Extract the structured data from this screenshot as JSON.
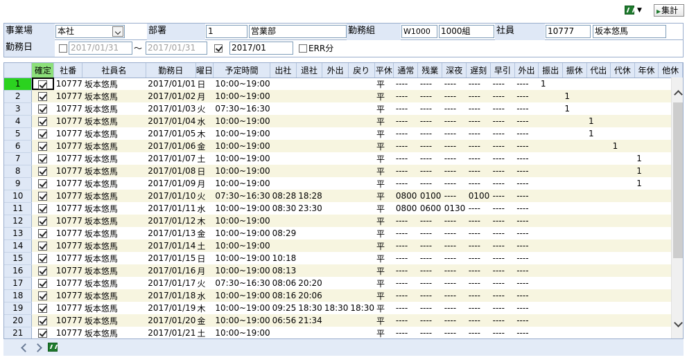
{
  "toolbar": {
    "excel_icon": "excel-icon",
    "sum_label": "集計"
  },
  "filter": {
    "office_label": "事業場",
    "office_value": "本社",
    "dept_label": "部署",
    "dept_code": "1",
    "dept_name": "営業部",
    "group_label": "勤務組",
    "group_code": "W1000",
    "group_name": "1000組",
    "employee_label": "社員",
    "employee_code": "10777",
    "employee_name": "坂本悠馬",
    "workdate_label": "勤務日",
    "date_from": "2017/01/31",
    "tilde": "～",
    "date_to": "2017/01/31",
    "month_value": "2017/01",
    "err_label": "ERR分"
  },
  "grid": {
    "columns": [
      "確定",
      "社番",
      "社員名",
      "勤務日",
      "曜日",
      "予定時間",
      "出社",
      "退社",
      "外出",
      "戻り",
      "平休",
      "通常",
      "残業",
      "深夜",
      "遅刻",
      "早引",
      "外出",
      "振出",
      "振休",
      "代出",
      "代休",
      "年休",
      "他休"
    ],
    "rows": [
      {
        "n": "1",
        "code": "10777",
        "name": "坂本悠馬",
        "date": "2017/01/01",
        "dow": "日",
        "plan": "10:00~19:00",
        "in": "",
        "out": "",
        "go": "",
        "back": "",
        "ph": "平",
        "n1": "----",
        "ot": "----",
        "ng": "----",
        "late": "----",
        "early": "----",
        "gout": "----",
        "fsh": "1",
        "fky": "",
        "dsh": "",
        "dky": "",
        "nen": "",
        "ta": ""
      },
      {
        "n": "2",
        "code": "10777",
        "name": "坂本悠馬",
        "date": "2017/01/02",
        "dow": "月",
        "plan": "10:00~19:00",
        "in": "",
        "out": "",
        "go": "",
        "back": "",
        "ph": "平",
        "n1": "----",
        "ot": "----",
        "ng": "----",
        "late": "----",
        "early": "----",
        "gout": "----",
        "fsh": "",
        "fky": "1",
        "dsh": "",
        "dky": "",
        "nen": "",
        "ta": ""
      },
      {
        "n": "3",
        "code": "10777",
        "name": "坂本悠馬",
        "date": "2017/01/03",
        "dow": "火",
        "plan": "07:30~16:30",
        "in": "",
        "out": "",
        "go": "",
        "back": "",
        "ph": "平",
        "n1": "----",
        "ot": "----",
        "ng": "----",
        "late": "----",
        "early": "----",
        "gout": "----",
        "fsh": "",
        "fky": "1",
        "dsh": "",
        "dky": "",
        "nen": "",
        "ta": ""
      },
      {
        "n": "4",
        "code": "10777",
        "name": "坂本悠馬",
        "date": "2017/01/04",
        "dow": "水",
        "plan": "10:00~19:00",
        "in": "",
        "out": "",
        "go": "",
        "back": "",
        "ph": "平",
        "n1": "----",
        "ot": "----",
        "ng": "----",
        "late": "----",
        "early": "----",
        "gout": "----",
        "fsh": "",
        "fky": "",
        "dsh": "1",
        "dky": "",
        "nen": "",
        "ta": ""
      },
      {
        "n": "5",
        "code": "10777",
        "name": "坂本悠馬",
        "date": "2017/01/05",
        "dow": "木",
        "plan": "10:00~19:00",
        "in": "",
        "out": "",
        "go": "",
        "back": "",
        "ph": "平",
        "n1": "----",
        "ot": "----",
        "ng": "----",
        "late": "----",
        "early": "----",
        "gout": "----",
        "fsh": "",
        "fky": "",
        "dsh": "1",
        "dky": "",
        "nen": "",
        "ta": ""
      },
      {
        "n": "6",
        "code": "10777",
        "name": "坂本悠馬",
        "date": "2017/01/06",
        "dow": "金",
        "plan": "10:00~19:00",
        "in": "",
        "out": "",
        "go": "",
        "back": "",
        "ph": "平",
        "n1": "----",
        "ot": "----",
        "ng": "----",
        "late": "----",
        "early": "----",
        "gout": "----",
        "fsh": "",
        "fky": "",
        "dsh": "",
        "dky": "1",
        "nen": "",
        "ta": ""
      },
      {
        "n": "7",
        "code": "10777",
        "name": "坂本悠馬",
        "date": "2017/01/07",
        "dow": "土",
        "plan": "10:00~19:00",
        "in": "",
        "out": "",
        "go": "",
        "back": "",
        "ph": "平",
        "n1": "----",
        "ot": "----",
        "ng": "----",
        "late": "----",
        "early": "----",
        "gout": "----",
        "fsh": "",
        "fky": "",
        "dsh": "",
        "dky": "",
        "nen": "1",
        "ta": ""
      },
      {
        "n": "8",
        "code": "10777",
        "name": "坂本悠馬",
        "date": "2017/01/08",
        "dow": "日",
        "plan": "10:00~19:00",
        "in": "",
        "out": "",
        "go": "",
        "back": "",
        "ph": "平",
        "n1": "----",
        "ot": "----",
        "ng": "----",
        "late": "----",
        "early": "----",
        "gout": "----",
        "fsh": "",
        "fky": "",
        "dsh": "",
        "dky": "",
        "nen": "1",
        "ta": ""
      },
      {
        "n": "9",
        "code": "10777",
        "name": "坂本悠馬",
        "date": "2017/01/09",
        "dow": "月",
        "plan": "10:00~19:00",
        "in": "",
        "out": "",
        "go": "",
        "back": "",
        "ph": "平",
        "n1": "----",
        "ot": "----",
        "ng": "----",
        "late": "----",
        "early": "----",
        "gout": "----",
        "fsh": "",
        "fky": "",
        "dsh": "",
        "dky": "",
        "nen": "1",
        "ta": ""
      },
      {
        "n": "10",
        "code": "10777",
        "name": "坂本悠馬",
        "date": "2017/01/10",
        "dow": "火",
        "plan": "07:30~16:30",
        "in": "08:28",
        "out": "18:28",
        "go": "",
        "back": "",
        "ph": "平",
        "n1": "0800",
        "ot": "0100",
        "ng": "----",
        "late": "0100",
        "early": "----",
        "gout": "----",
        "fsh": "",
        "fky": "",
        "dsh": "",
        "dky": "",
        "nen": "",
        "ta": ""
      },
      {
        "n": "11",
        "code": "10777",
        "name": "坂本悠馬",
        "date": "2017/01/11",
        "dow": "水",
        "plan": "10:00~19:00",
        "in": "08:30",
        "out": "23:30",
        "go": "",
        "back": "",
        "ph": "平",
        "n1": "0800",
        "ot": "0600",
        "ng": "0130",
        "late": "----",
        "early": "----",
        "gout": "----",
        "fsh": "",
        "fky": "",
        "dsh": "",
        "dky": "",
        "nen": "",
        "ta": ""
      },
      {
        "n": "12",
        "code": "10777",
        "name": "坂本悠馬",
        "date": "2017/01/12",
        "dow": "木",
        "plan": "10:00~19:00",
        "in": "",
        "out": "",
        "go": "",
        "back": "",
        "ph": "平",
        "n1": "----",
        "ot": "----",
        "ng": "----",
        "late": "----",
        "early": "----",
        "gout": "----",
        "fsh": "",
        "fky": "",
        "dsh": "",
        "dky": "",
        "nen": "",
        "ta": ""
      },
      {
        "n": "13",
        "code": "10777",
        "name": "坂本悠馬",
        "date": "2017/01/13",
        "dow": "金",
        "plan": "10:00~19:00",
        "in": "08:29",
        "out": "",
        "go": "",
        "back": "",
        "ph": "平",
        "n1": "----",
        "ot": "----",
        "ng": "----",
        "late": "----",
        "early": "----",
        "gout": "----",
        "fsh": "",
        "fky": "",
        "dsh": "",
        "dky": "",
        "nen": "",
        "ta": ""
      },
      {
        "n": "14",
        "code": "10777",
        "name": "坂本悠馬",
        "date": "2017/01/14",
        "dow": "土",
        "plan": "10:00~19:00",
        "in": "",
        "out": "",
        "go": "",
        "back": "",
        "ph": "平",
        "n1": "----",
        "ot": "----",
        "ng": "----",
        "late": "----",
        "early": "----",
        "gout": "----",
        "fsh": "",
        "fky": "",
        "dsh": "",
        "dky": "",
        "nen": "",
        "ta": ""
      },
      {
        "n": "15",
        "code": "10777",
        "name": "坂本悠馬",
        "date": "2017/01/15",
        "dow": "日",
        "plan": "10:00~19:00",
        "in": "10:18",
        "out": "",
        "go": "",
        "back": "",
        "ph": "平",
        "n1": "----",
        "ot": "----",
        "ng": "----",
        "late": "----",
        "early": "----",
        "gout": "----",
        "fsh": "",
        "fky": "",
        "dsh": "",
        "dky": "",
        "nen": "",
        "ta": ""
      },
      {
        "n": "16",
        "code": "10777",
        "name": "坂本悠馬",
        "date": "2017/01/16",
        "dow": "月",
        "plan": "10:00~19:00",
        "in": "08:13",
        "out": "",
        "go": "",
        "back": "",
        "ph": "平",
        "n1": "----",
        "ot": "----",
        "ng": "----",
        "late": "----",
        "early": "----",
        "gout": "----",
        "fsh": "",
        "fky": "",
        "dsh": "",
        "dky": "",
        "nen": "",
        "ta": ""
      },
      {
        "n": "17",
        "code": "10777",
        "name": "坂本悠馬",
        "date": "2017/01/17",
        "dow": "火",
        "plan": "07:30~16:30",
        "in": "08:06",
        "out": "20:20",
        "go": "",
        "back": "",
        "ph": "平",
        "n1": "----",
        "ot": "----",
        "ng": "----",
        "late": "----",
        "early": "----",
        "gout": "----",
        "fsh": "",
        "fky": "",
        "dsh": "",
        "dky": "",
        "nen": "",
        "ta": ""
      },
      {
        "n": "18",
        "code": "10777",
        "name": "坂本悠馬",
        "date": "2017/01/18",
        "dow": "水",
        "plan": "10:00~19:00",
        "in": "08:16",
        "out": "20:06",
        "go": "",
        "back": "",
        "ph": "平",
        "n1": "----",
        "ot": "----",
        "ng": "----",
        "late": "----",
        "early": "----",
        "gout": "----",
        "fsh": "",
        "fky": "",
        "dsh": "",
        "dky": "",
        "nen": "",
        "ta": ""
      },
      {
        "n": "19",
        "code": "10777",
        "name": "坂本悠馬",
        "date": "2017/01/19",
        "dow": "木",
        "plan": "10:00~19:00",
        "in": "09:25",
        "out": "18:30",
        "go": "18:30",
        "back": "18:30",
        "ph": "平",
        "n1": "----",
        "ot": "----",
        "ng": "----",
        "late": "----",
        "early": "----",
        "gout": "----",
        "fsh": "",
        "fky": "",
        "dsh": "",
        "dky": "",
        "nen": "",
        "ta": ""
      },
      {
        "n": "20",
        "code": "10777",
        "name": "坂本悠馬",
        "date": "2017/01/20",
        "dow": "金",
        "plan": "10:00~19:00",
        "in": "06:56",
        "out": "21:34",
        "go": "",
        "back": "",
        "ph": "平",
        "n1": "----",
        "ot": "----",
        "ng": "----",
        "late": "----",
        "early": "----",
        "gout": "----",
        "fsh": "",
        "fky": "",
        "dsh": "",
        "dky": "",
        "nen": "",
        "ta": ""
      },
      {
        "n": "21",
        "code": "10777",
        "name": "坂本悠馬",
        "date": "2017/01/21",
        "dow": "土",
        "plan": "10:00~19:00",
        "in": "",
        "out": "",
        "go": "",
        "back": "",
        "ph": "平",
        "n1": "----",
        "ot": "----",
        "ng": "----",
        "late": "----",
        "early": "----",
        "gout": "----",
        "fsh": "",
        "fky": "",
        "dsh": "",
        "dky": "",
        "nen": "",
        "ta": ""
      }
    ]
  },
  "pager": {
    "prev_icon": "chevron-left-icon",
    "next_icon": "chevron-right-icon",
    "export_icon": "excel-icon"
  },
  "colors": {
    "header_bg": "#dfe8f6",
    "selected_green": "#2bd21f",
    "confirm_header": "#8ce07a",
    "alt_row": "#f7f5e0"
  }
}
